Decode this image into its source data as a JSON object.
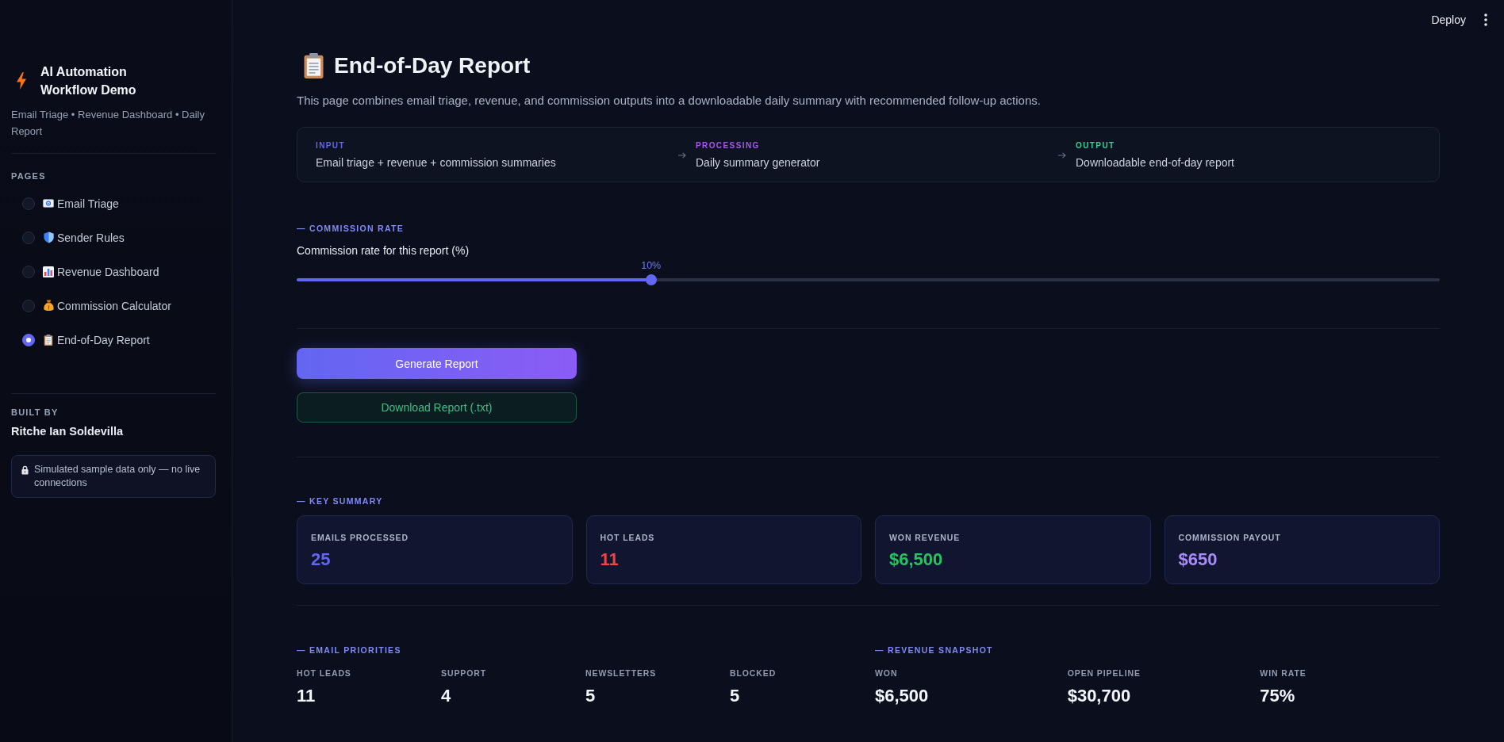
{
  "top_bar": {
    "deploy": "Deploy"
  },
  "sidebar": {
    "app_title": "AI Automation Workflow Demo",
    "subtitle": "Email Triage • Revenue Dashboard • Daily Report",
    "pages_heading": "PAGES",
    "pages": [
      {
        "label": "Email Triage",
        "selected": false
      },
      {
        "label": "Sender Rules",
        "selected": false
      },
      {
        "label": "Revenue Dashboard",
        "selected": false
      },
      {
        "label": "Commission Calculator",
        "selected": false
      },
      {
        "label": "End-of-Day Report",
        "selected": true
      }
    ],
    "built_by_heading": "BUILT BY",
    "author": "Ritche Ian Soldevilla",
    "notice": "Simulated sample data only — no live connections"
  },
  "page": {
    "title": "End-of-Day Report",
    "description": "This page combines email triage, revenue, and commission outputs into a downloadable daily summary with recommended follow-up actions.",
    "pipeline": [
      {
        "label": "INPUT",
        "color": "#6366f1",
        "text": "Email triage + revenue + commission summaries"
      },
      {
        "label": "PROCESSING",
        "color": "#a855f7",
        "text": "Daily summary generator"
      },
      {
        "label": "OUTPUT",
        "color": "#34d399",
        "text": "Downloadable end-of-day report"
      }
    ]
  },
  "commission_rate": {
    "heading": "— COMMISSION RATE",
    "label": "Commission rate for this report (%)",
    "value": "10%",
    "level": 0.31
  },
  "actions": [
    {
      "label": "Generate Report",
      "kind": "primary"
    },
    {
      "label": "Download Report (.txt)",
      "kind": "secondary"
    }
  ],
  "key_summary": {
    "heading": "— KEY SUMMARY",
    "cards": [
      {
        "label": "EMAILS PROCESSED",
        "value": "25",
        "color": "#6366f1"
      },
      {
        "label": "HOT LEADS",
        "value": "11",
        "color": "#ef4444"
      },
      {
        "label": "WON REVENUE",
        "value": "$6,500",
        "color": "#22c55e"
      },
      {
        "label": "COMMISSION PAYOUT",
        "value": "$650",
        "color": "#a78bfa"
      }
    ]
  },
  "email_priorities": {
    "heading": "— EMAIL PRIORITIES",
    "stats": [
      {
        "label": "HOT LEADS",
        "value": "11"
      },
      {
        "label": "SUPPORT",
        "value": "4"
      },
      {
        "label": "NEWSLETTERS",
        "value": "5"
      },
      {
        "label": "BLOCKED",
        "value": "5"
      }
    ]
  },
  "revenue_snapshot": {
    "heading": "— REVENUE SNAPSHOT",
    "stats": [
      {
        "label": "WON",
        "value": "$6,500"
      },
      {
        "label": "OPEN PIPELINE",
        "value": "$30,700"
      },
      {
        "label": "WIN RATE",
        "value": "75%"
      }
    ]
  }
}
